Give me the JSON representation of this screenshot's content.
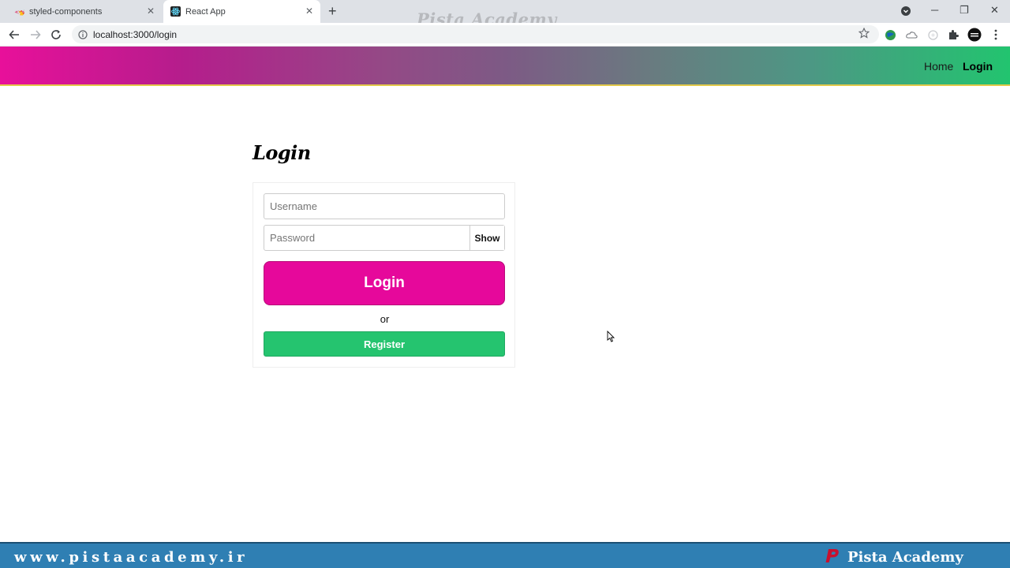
{
  "browser": {
    "tabs": [
      {
        "title": "styled-components",
        "active": false
      },
      {
        "title": "React App",
        "active": true
      }
    ],
    "url": "localhost:3000/login",
    "overlay_watermark": "Pista Academy"
  },
  "header": {
    "nav": [
      {
        "label": "Home",
        "active": false
      },
      {
        "label": "Login",
        "active": true
      }
    ],
    "gradient_colors": [
      "#e8109a",
      "#944986",
      "#22c46f"
    ]
  },
  "login": {
    "title": "Login",
    "username_placeholder": "Username",
    "password_placeholder": "Password",
    "show_label": "Show",
    "submit_label": "Login",
    "or_text": "or",
    "register_label": "Register",
    "colors": {
      "login_button": "#e6089b",
      "register_button": "#25c46f"
    }
  },
  "footer_band": {
    "website": "www.pistaacademy.ir",
    "brand": "Pista Academy",
    "background": "#2f7fb3"
  }
}
